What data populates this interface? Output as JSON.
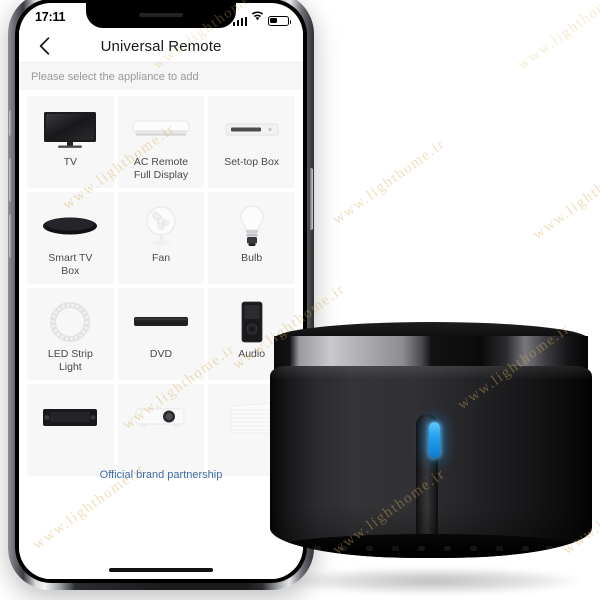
{
  "watermark": {
    "text": "www.lighthome.ir"
  },
  "phone": {
    "status_bar": {
      "clock": "17:11",
      "signal_icon": "cellular-bars-icon",
      "wifi_icon": "wifi-icon",
      "battery_icon": "battery-icon",
      "battery_level_percent": 42
    },
    "nav_bar": {
      "back_icon": "chevron-left-icon",
      "title": "Universal Remote"
    },
    "hint": {
      "text": "Please select the appliance to add"
    },
    "appliances": [
      {
        "label": "TV",
        "icon": "tv-icon"
      },
      {
        "label": "AC Remote\nFull Display",
        "icon": "air-conditioner-icon"
      },
      {
        "label": "Set-top Box",
        "icon": "set-top-box-icon"
      },
      {
        "label": "Smart TV\nBox",
        "icon": "smart-tv-box-icon"
      },
      {
        "label": "Fan",
        "icon": "fan-icon"
      },
      {
        "label": "Bulb",
        "icon": "bulb-icon"
      },
      {
        "label": "LED Strip\nLight",
        "icon": "led-strip-light-icon"
      },
      {
        "label": "DVD",
        "icon": "dvd-player-icon"
      },
      {
        "label": "Audio",
        "icon": "audio-icon"
      },
      {
        "label": "",
        "icon": "av-receiver-icon"
      },
      {
        "label": "",
        "icon": "projector-icon"
      },
      {
        "label": "",
        "icon": "curtain-icon"
      }
    ],
    "partnership_link": "Official brand partnership",
    "home_indicator": "home-indicator"
  },
  "device": {
    "name": "ir-blaster-hub",
    "led_color": "#2196e8",
    "body_color": "#1c1c1f",
    "band_color": "#b5b5b8"
  }
}
